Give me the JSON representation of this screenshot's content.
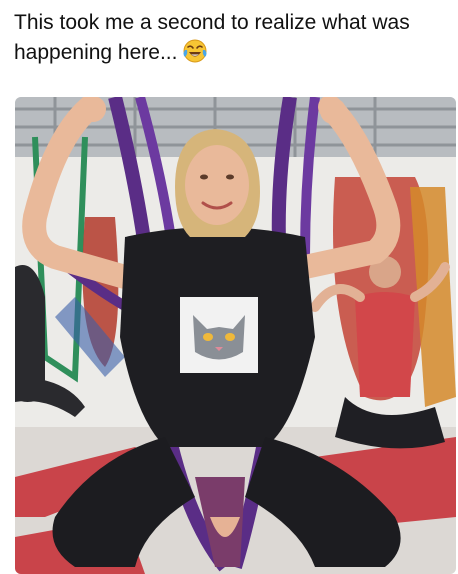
{
  "post": {
    "caption_text": "This took me a second to realize what was happening here...",
    "caption_emoji": "face-with-tears-of-joy-icon"
  },
  "photo": {
    "subject": "Woman smiling in a purple aerial yoga hammock in a fitness studio",
    "shirt_print": "cat face graphic",
    "colors": {
      "hammock_main": "#5a2d86",
      "hammock_bg": "#c23a2a",
      "shirt": "#1e1e22",
      "floor_mat": "#c9444a",
      "skin": "#e9b99a",
      "hair": "#d6b57a"
    }
  }
}
